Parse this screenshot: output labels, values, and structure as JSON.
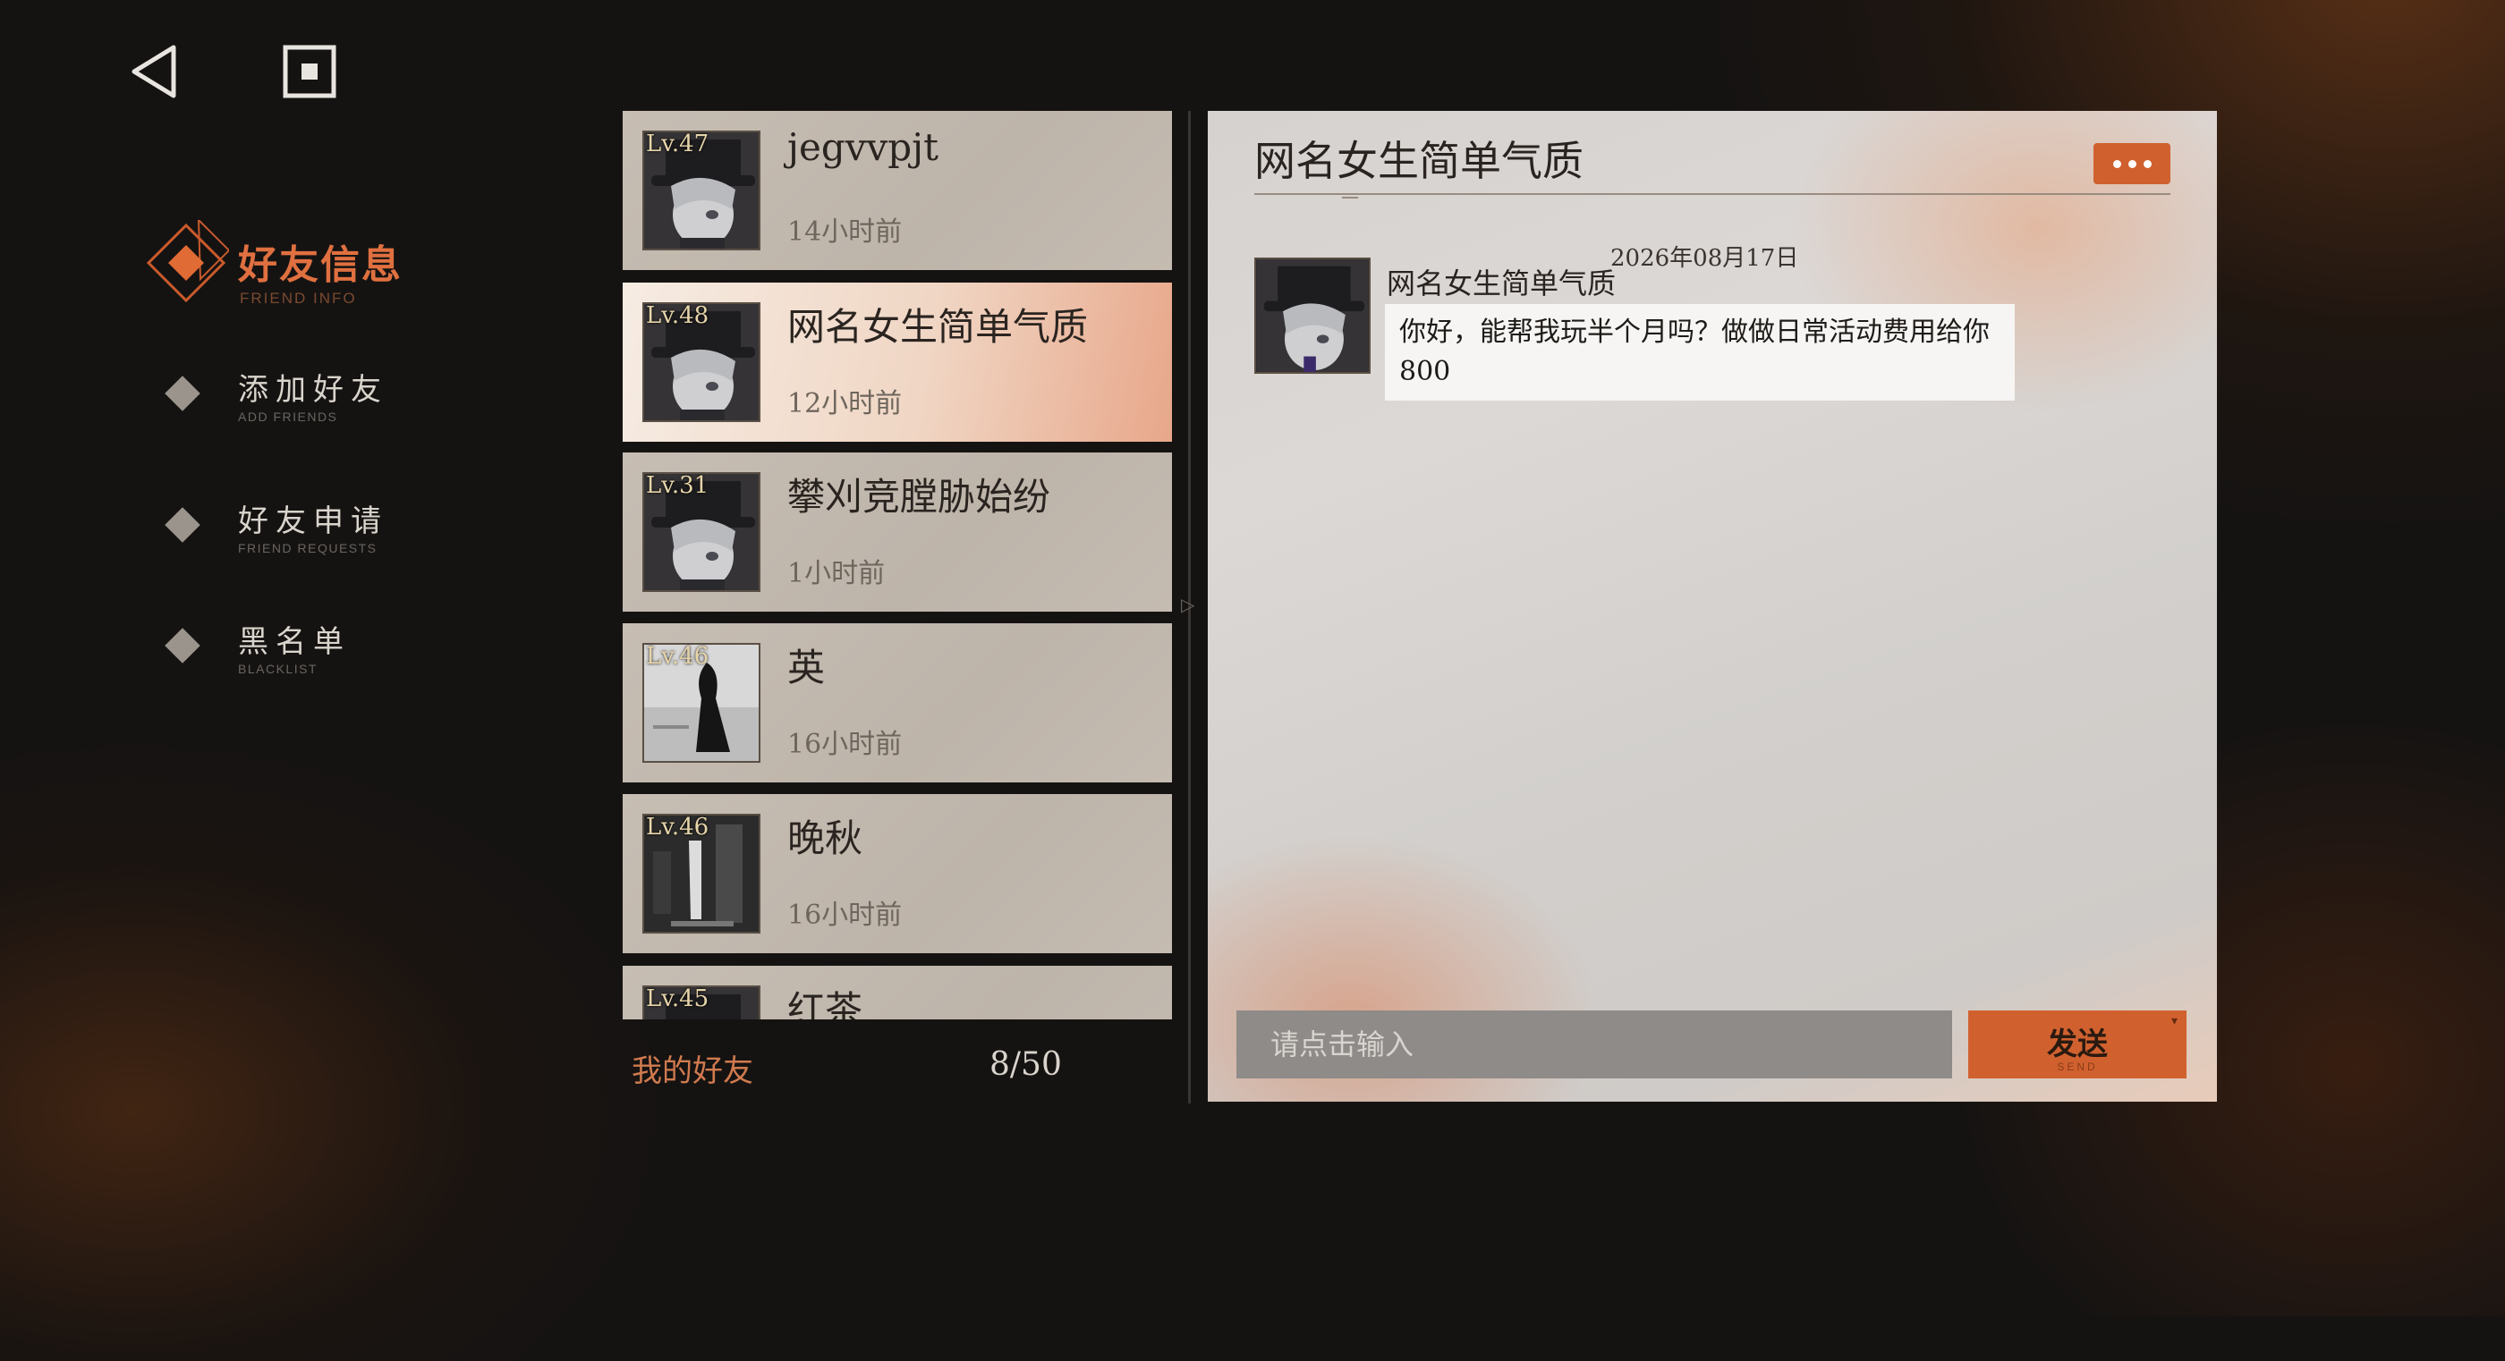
{
  "sidebar": {
    "header_title": "好友信息",
    "header_sub": "FRIEND INFO",
    "items": [
      {
        "label": "添加好友",
        "sub": "ADD FRIENDS"
      },
      {
        "label": "好友申请",
        "sub": "FRIEND REQUESTS"
      },
      {
        "label": "黑名单",
        "sub": "BLACKLIST"
      }
    ]
  },
  "friends": [
    {
      "level": "Lv.47",
      "name": "jegvvpjt",
      "time": "14小时前"
    },
    {
      "level": "Lv.48",
      "name": "网名女生简单气质",
      "time": "12小时前",
      "active": true
    },
    {
      "level": "Lv.31",
      "name": "攀刈竞膛胁始纷",
      "time": "1小时前"
    },
    {
      "level": "Lv.46",
      "name": "英",
      "time": "16小时前"
    },
    {
      "level": "Lv.46",
      "name": "晚秋",
      "time": "16小时前"
    },
    {
      "level": "Lv.45",
      "name": "红茶",
      "time": ""
    }
  ],
  "list_footer": {
    "label": "我的好友",
    "count": "8/50"
  },
  "chat": {
    "title": "网名女生简单气质",
    "date": "2026年08月17日",
    "sender": "网名女生简单气质",
    "message": "你好，能帮我玩半个月吗？做做日常活动费用给你800",
    "input_placeholder": "请点击输入",
    "send_label": "发送",
    "send_sub": "SEND"
  },
  "colors": {
    "accent": "#d0612f",
    "active_card": "#f0d6c4",
    "card": "#c2b9af",
    "bg": "#151312"
  }
}
